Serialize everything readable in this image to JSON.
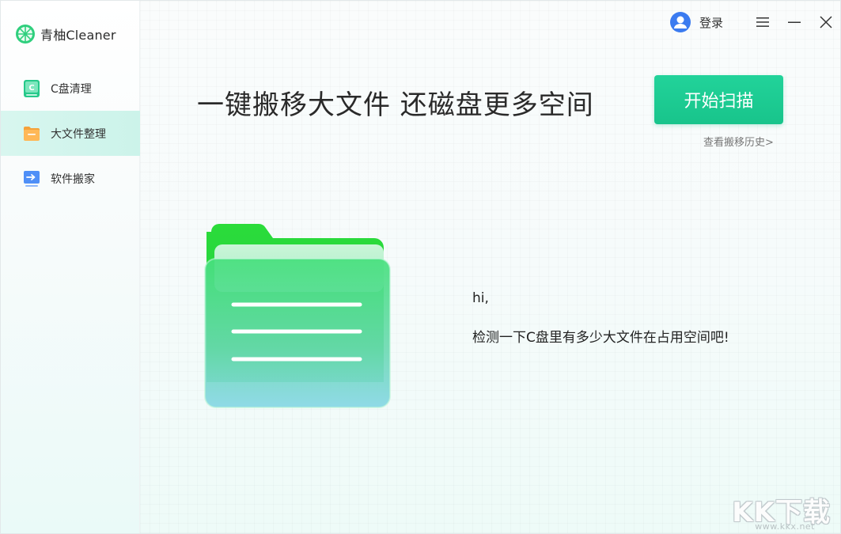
{
  "app": {
    "name": "青柚Cleaner"
  },
  "sidebar": {
    "items": [
      {
        "label": "C盘清理",
        "icon": "c-drive-icon",
        "active": false
      },
      {
        "label": "大文件整理",
        "icon": "folder-icon",
        "active": true
      },
      {
        "label": "软件搬家",
        "icon": "software-move-icon",
        "active": false
      }
    ]
  },
  "topbar": {
    "login_label": "登录",
    "icons": [
      "user-avatar-icon",
      "menu-icon",
      "minimize-icon",
      "close-icon"
    ]
  },
  "main": {
    "headline": "一键搬移大文件 还磁盘更多空间",
    "scan_button": "开始扫描",
    "history_link": "查看搬移历史>",
    "greeting": "hi,",
    "description": "检测一下C盘里有多少大文件在占用空间吧!"
  },
  "watermark": {
    "text": "KK下载",
    "url": "www.kkx.net"
  },
  "colors": {
    "accent": "#1ccb90",
    "active_nav": "#d3f5ed",
    "text": "#222222"
  }
}
